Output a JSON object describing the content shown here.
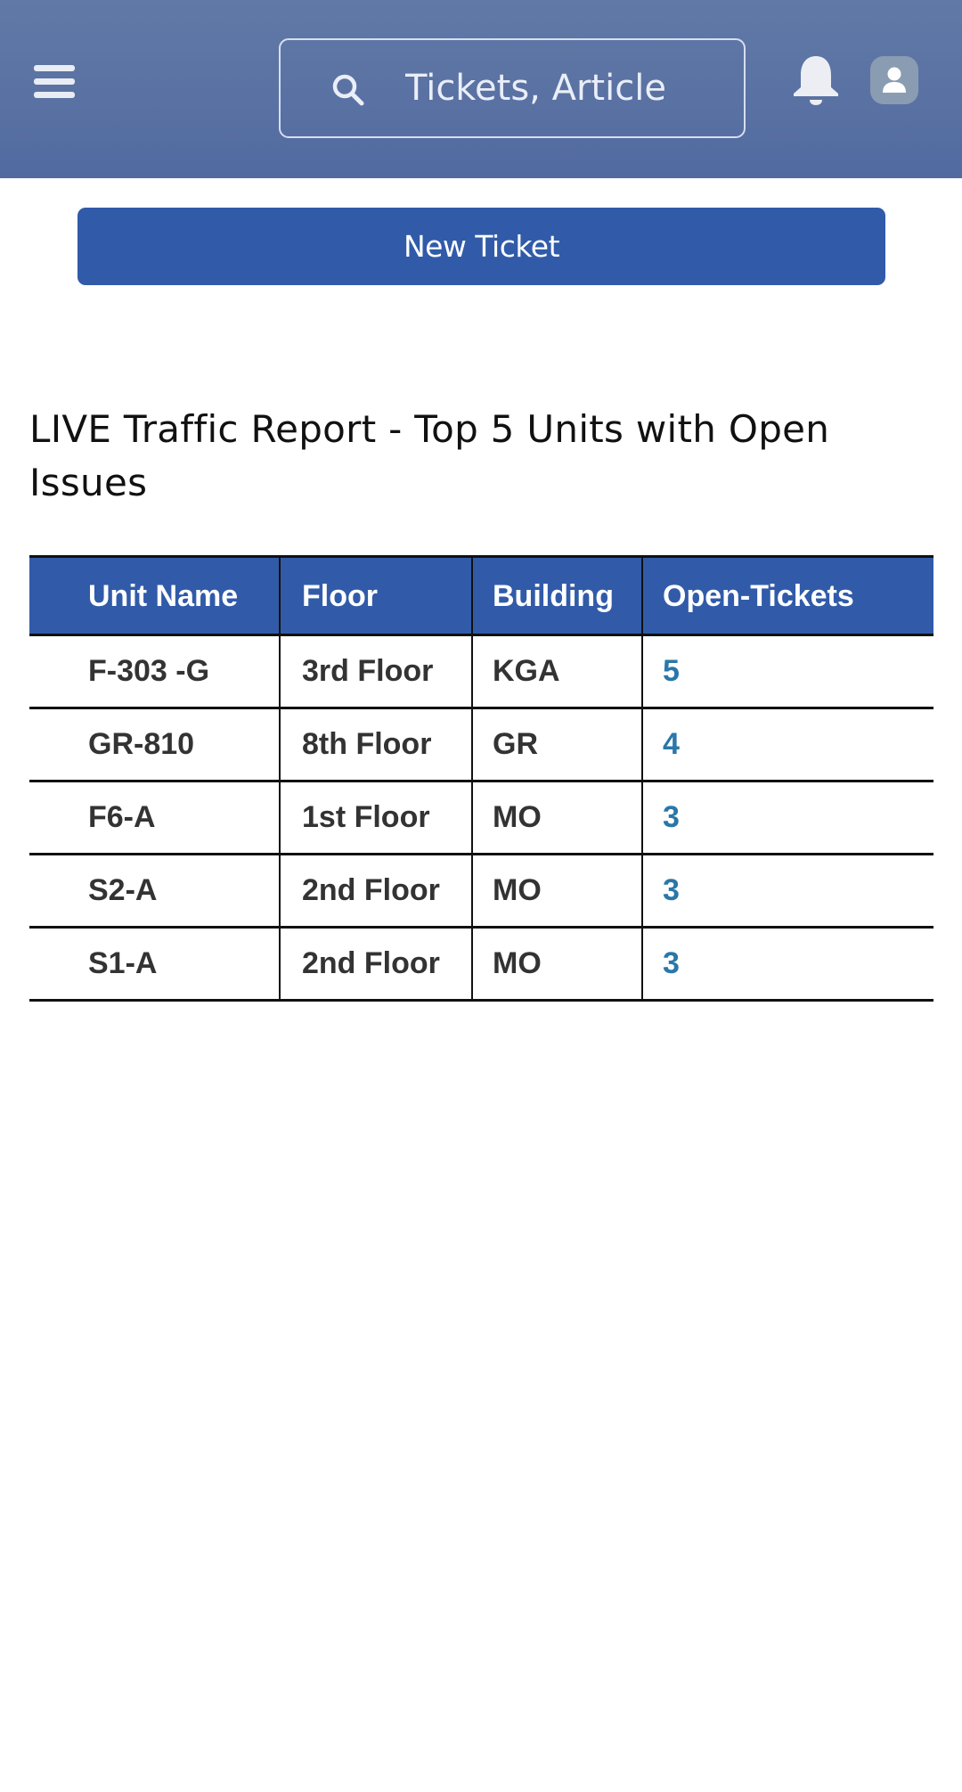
{
  "header": {
    "menu_icon": "hamburger-menu-icon",
    "search": {
      "placeholder": "Tickets, Article",
      "value": "",
      "icon": "search-icon"
    },
    "notifications_icon": "bell-icon",
    "avatar_icon": "user-icon"
  },
  "actions": {
    "new_ticket_label": "New Ticket"
  },
  "report": {
    "title": "LIVE Traffic Report - Top 5 Units with Open Issues",
    "columns": [
      "Unit Name",
      "Floor",
      "Building",
      "Open-Tickets"
    ],
    "rows": [
      {
        "unit": "F-303 -G",
        "floor": "3rd Floor",
        "building": "KGA",
        "open_tickets": "5"
      },
      {
        "unit": "GR-810",
        "floor": "8th Floor",
        "building": "GR",
        "open_tickets": "4"
      },
      {
        "unit": "F6-A",
        "floor": "1st Floor",
        "building": "MO",
        "open_tickets": "3"
      },
      {
        "unit": "S2-A",
        "floor": "2nd Floor",
        "building": "MO",
        "open_tickets": "3"
      },
      {
        "unit": "S1-A",
        "floor": "2nd Floor",
        "building": "MO",
        "open_tickets": "3"
      }
    ]
  },
  "colors": {
    "header_bg": "#5a72a3",
    "primary": "#315ba9",
    "link": "#2a77a8",
    "avatar_bg": "#8a9cb2"
  }
}
